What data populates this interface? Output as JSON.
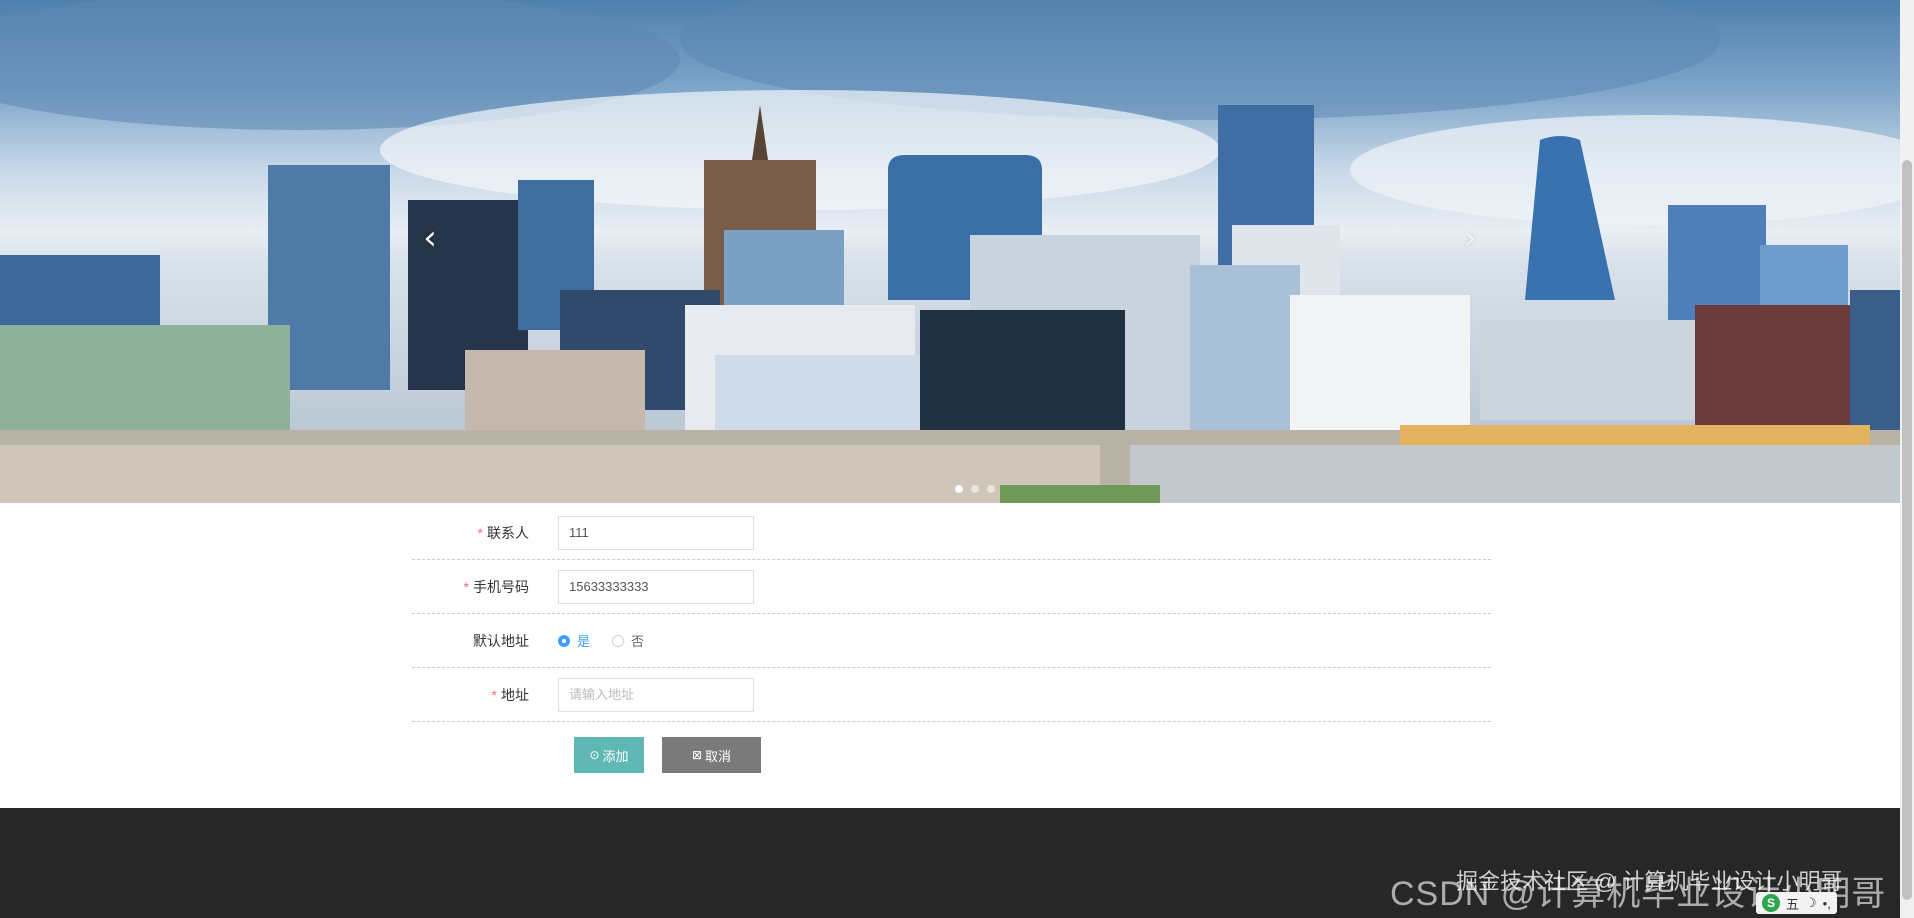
{
  "hero": {
    "prev_icon": "‹",
    "next_icon": "›",
    "slides": 3
  },
  "form": {
    "contact": {
      "label": "联系人",
      "value": "111"
    },
    "phone": {
      "label": "手机号码",
      "value": "15633333333"
    },
    "default_address": {
      "label": "默认地址",
      "options": [
        "是",
        "否"
      ],
      "selected": "是"
    },
    "address": {
      "label": "地址",
      "value": "",
      "placeholder": "请输入地址"
    },
    "required_mark": "*"
  },
  "actions": {
    "add_label": "添加",
    "add_icon": "⊙",
    "cancel_label": "取消",
    "cancel_icon": "⊠"
  },
  "footer": {
    "watermark_juejin": "掘金技术社区 @ 计算机毕业设计小明哥",
    "watermark_csdn": "CSDN @计算机毕业设计小明哥"
  },
  "taskbar": {
    "ime_logo": "S",
    "ime_mode": "五",
    "moon": "☽",
    "dot": "•,"
  },
  "colors": {
    "primary": "#409eff",
    "add_button": "#5fb8b4",
    "cancel_button": "#7a7a7a",
    "required": "#f56c6c",
    "footer": "#272727"
  }
}
